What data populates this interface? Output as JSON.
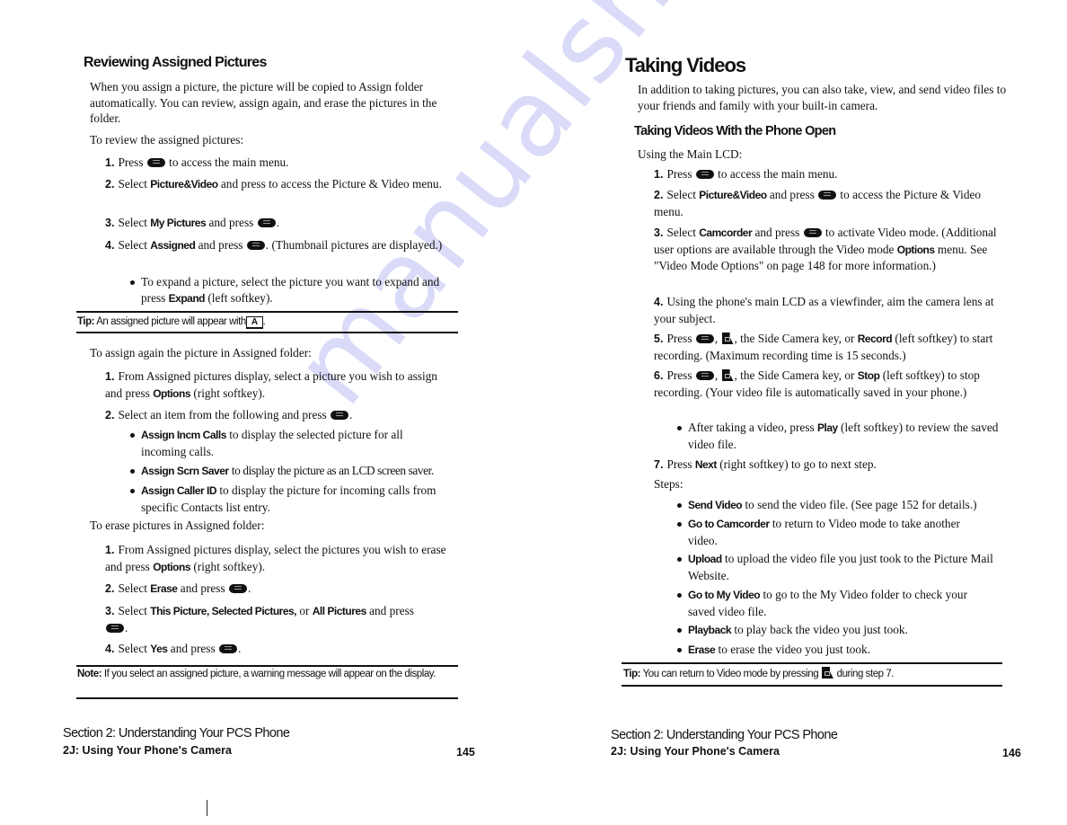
{
  "watermark": "manualshive.com",
  "left_page": {
    "heading": "Reviewing Assigned Pictures",
    "intro": "When you assign a picture, the picture will be copied to Assign folder automatically. You can review, assign again, and erase the pictures in the folder.",
    "review_lead": "To review the assigned pictures:",
    "review_steps": [
      {
        "num": "1.",
        "pre": "Press",
        "icon": "menu-ok-key",
        "post": "to access the main menu."
      },
      {
        "num": "2.",
        "pre": "Select",
        "bold": "Picture&Video",
        "post": "and press to access the Picture & Video menu."
      },
      {
        "num": "3.",
        "pre": "Select",
        "bold": "My Pictures",
        "post": "and press",
        "icon": "menu-ok-key",
        "end": "."
      },
      {
        "num": "4.",
        "pre": "Select",
        "bold": "Assigned",
        "post": "and press",
        "icon": "menu-ok-key",
        "end": ". (Thumbnail pictures are displayed.)"
      }
    ],
    "review_bullet": {
      "pre": "To expand a picture, select the picture you want to expand and press",
      "bold": "Expand",
      "post": "(left softkey)."
    },
    "tip": {
      "label": "Tip:",
      "text": "An assigned picture will appear with",
      "icon_label": "A",
      "end": "."
    },
    "assign_lead": "To assign again the picture in Assigned folder:",
    "assign_steps": [
      {
        "num": "1.",
        "pre": "From Assigned pictures display, select a picture you wish to assign and press",
        "bold": "Options",
        "post": "(right softkey)."
      },
      {
        "num": "2.",
        "pre": "Select an item from the following and press",
        "icon": "menu-ok-key",
        "end": "."
      }
    ],
    "assign_bullets": [
      {
        "bold": "Assign Incm Calls",
        "text": "to display the selected picture for all incoming calls."
      },
      {
        "bold": "Assign Scrn Saver",
        "text": "to display the picture as an LCD screen saver."
      },
      {
        "bold": "Assign Caller ID",
        "text": "to display the picture for incoming calls from specific Contacts list entry."
      }
    ],
    "erase_lead": "To erase pictures in Assigned folder:",
    "erase_steps": [
      {
        "num": "1.",
        "pre": "From Assigned pictures display, select the pictures you wish to erase and press",
        "bold": "Options",
        "post": "(right softkey)."
      },
      {
        "num": "2.",
        "pre": "Select",
        "bold": "Erase",
        "post": "and press",
        "icon": "menu-ok-key",
        "end": "."
      },
      {
        "num": "3.",
        "pre": "Select",
        "bold1": "This Picture, Selected Pictures,",
        "mid": "or",
        "bold2": "All Pictures",
        "post": "and press",
        "icon": "menu-ok-key",
        "end": "."
      },
      {
        "num": "4.",
        "pre": "Select",
        "bold": "Yes",
        "post": "and press",
        "icon": "menu-ok-key",
        "end": "."
      }
    ],
    "note": {
      "label": "Note:",
      "text": "If you select an assigned picture, a warning message will appear on the display."
    },
    "footer": {
      "section": "Section 2: Understanding Your PCS Phone",
      "chapter": "2J: Using Your Phone's Camera",
      "page": "145"
    }
  },
  "right_page": {
    "heading": "Taking Videos",
    "intro": "In addition to taking pictures, you can also take, view, and send video files to your friends and family with your built-in camera.",
    "subheading": "Taking Videos With the Phone Open",
    "lead": "Using the Main LCD:",
    "steps": [
      {
        "num": "1.",
        "pre": "Press",
        "icon": "menu-ok-key",
        "post": "to access the main menu."
      },
      {
        "num": "2.",
        "pre": "Select",
        "bold": "Picture&Video",
        "post": "and press",
        "icon": "menu-ok-key",
        "end": "to access the Picture & Video menu."
      },
      {
        "num": "3.",
        "pre": "Select",
        "bold": "Camcorder",
        "post": "and press",
        "icon": "menu-ok-key",
        "end": "to activate Video mode. (Additional user options are available through the Video mode",
        "bold2": "Options",
        "end2": "menu. See \"Video Mode Options\" on page 148 for more information.)"
      },
      {
        "num": "4.",
        "text": "Using the phone's main LCD as a viewfinder, aim the camera lens at your subject."
      },
      {
        "num": "5.",
        "pre": "Press",
        "icon": "menu-ok-key",
        "icon2": "side-camera-key",
        "mid": ", the Side Camera key, or",
        "bold": "Record",
        "post": "(left softkey) to start recording. (Maximum recording time is 15 seconds.)"
      },
      {
        "num": "6.",
        "pre": "Press",
        "icon": "menu-ok-key",
        "icon2": "side-camera-key",
        "mid": ", the Side Camera key, or",
        "bold": "Stop",
        "post": "(left softkey) to stop recording. (Your video file is automatically saved in your phone.)"
      },
      {
        "num": "7.",
        "pre": "Press",
        "bold": "Next",
        "post": "(right softkey) to go to next step."
      }
    ],
    "step6_bullet": {
      "pre": "After taking a video, press",
      "bold": "Play",
      "post": "(left softkey) to review the saved video file."
    },
    "steps_label": "Steps:",
    "options": [
      {
        "bold": "Send Video",
        "text": "to send the video file. (See page 152 for details.)"
      },
      {
        "bold": "Go to Camcorder",
        "text": "to return to Video mode to take another video."
      },
      {
        "bold": "Upload",
        "text": "to upload the video file you just took to the Picture Mail Website."
      },
      {
        "bold": "Go to My Video",
        "text": "to go to the My Video folder to check your saved video file."
      },
      {
        "bold": "Playback",
        "text": "to play back the video you just took."
      },
      {
        "bold": "Erase",
        "text": "to erase the video you just took."
      }
    ],
    "tip": {
      "label": "Tip:",
      "text": "You can return to Video mode by pressing",
      "end": "during step 7."
    },
    "footer": {
      "section": "Section 2: Understanding Your PCS Phone",
      "chapter": "2J: Using Your Phone's Camera",
      "page": "146"
    }
  }
}
